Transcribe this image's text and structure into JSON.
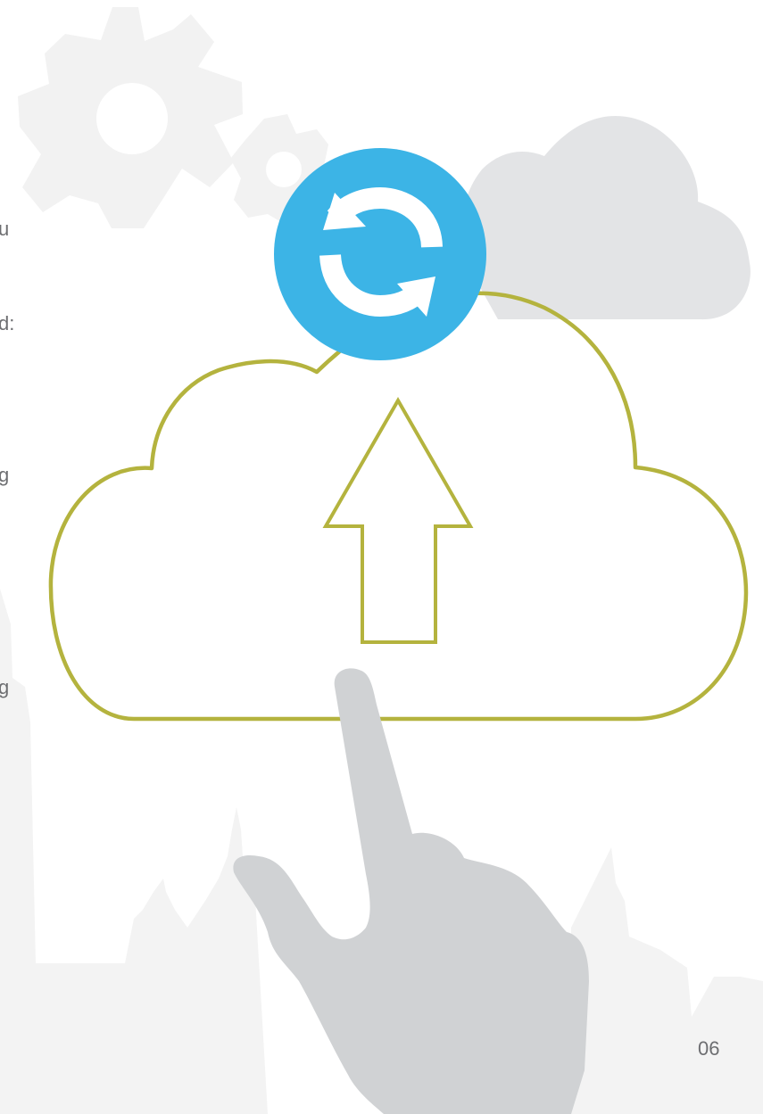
{
  "page": {
    "number": "06"
  },
  "clipped_text": [
    "u",
    "d:",
    "g",
    "g"
  ],
  "colors": {
    "background": "#ffffff",
    "gear": "#f2f2f2",
    "skyline": "#f3f3f3",
    "grey_cloud": "#e3e4e6",
    "upload_cloud_outline": "#b4b33e",
    "sync_badge": "#3cb4e6",
    "hand": "#d0d2d4",
    "text": "#6d6e71"
  },
  "icons": [
    "gear-icon",
    "cloud-icon",
    "upload-cloud-icon",
    "up-arrow-icon",
    "sync-icon",
    "pointing-hand-icon"
  ]
}
